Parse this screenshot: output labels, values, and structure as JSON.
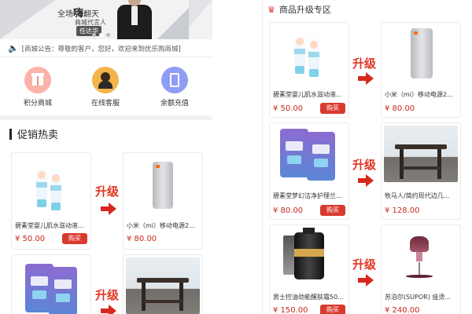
{
  "banner": {
    "headline_pre": "全场",
    "headline_big": "嗨",
    "headline_post": "翻天",
    "subtitle": "商城代言人",
    "speaker": "任达华"
  },
  "notice": {
    "text": "[商城公告：尊敬的客户，您好，欢迎来到优乐购商城]"
  },
  "shortcuts": [
    {
      "label": "积分商城",
      "icon": "gift-icon"
    },
    {
      "label": "在线客服",
      "icon": "customer-service-icon"
    },
    {
      "label": "余额充值",
      "icon": "tablet-icon"
    }
  ],
  "promo": {
    "title": "促销热卖",
    "upgrade_label": "升级",
    "rows": [
      {
        "left": {
          "name": "碧素堂婴儿肌水滋动液...",
          "price": "¥ 50.00",
          "buy": "购买"
        },
        "right": {
          "name": "小米（mi）移动电源2...",
          "price": "¥ 80.00"
        }
      },
      {
        "left": {
          "name": "",
          "price": "",
          "buy": ""
        },
        "right": {
          "name": "",
          "price": ""
        }
      }
    ]
  },
  "upgrade_zone": {
    "title": "商品升级专区",
    "upgrade_label": "升级",
    "rows": [
      {
        "left": {
          "name": "碧素堂婴儿肌水滋动液...",
          "price": "¥ 50.00",
          "buy": "购买"
        },
        "right": {
          "name": "小米（mi）移动电源2...",
          "price": "¥ 80.00"
        }
      },
      {
        "left": {
          "name": "碧素堂梦幻洁净护理兰...",
          "price": "¥ 80.00",
          "buy": "购买"
        },
        "right": {
          "name": "牧马人/简约现代边几...",
          "price": "¥ 128.00"
        }
      },
      {
        "left": {
          "name": "男士控油劲能醒肤霜50...",
          "price": "¥ 150.00",
          "buy": "购买"
        },
        "right": {
          "name": "苏泊尔(SUPOR) 挂烫...",
          "price": "¥ 240.00"
        }
      }
    ]
  },
  "colors": {
    "accent": "#d93a2e",
    "price": "#c8281e",
    "arrow": "#d8281e"
  }
}
